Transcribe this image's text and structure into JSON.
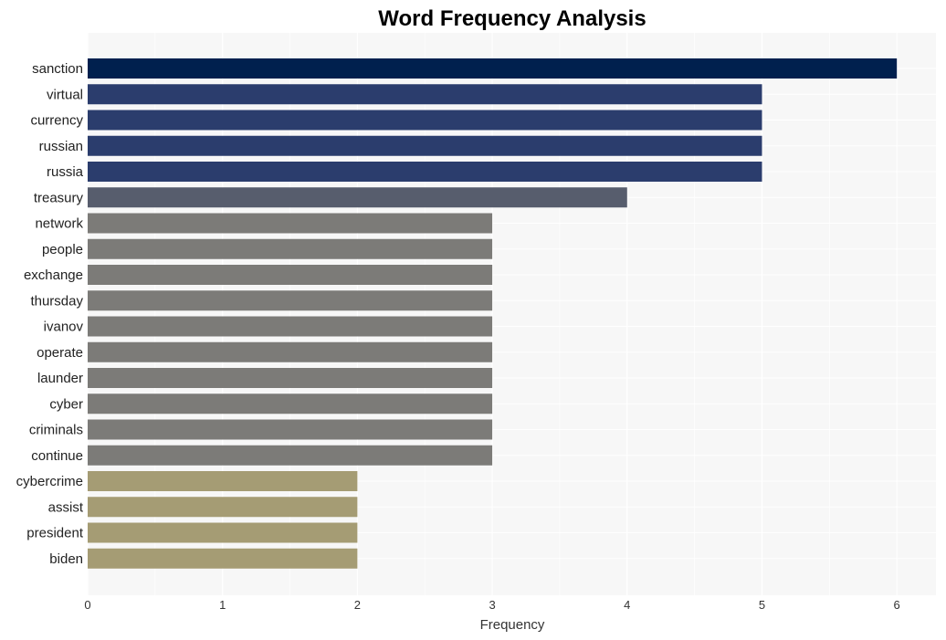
{
  "chart_data": {
    "type": "bar",
    "orientation": "horizontal",
    "title": "Word Frequency Analysis",
    "xlabel": "Frequency",
    "ylabel": "",
    "xlim": [
      0,
      6.29
    ],
    "xticks": [
      0,
      1,
      2,
      3,
      4,
      5,
      6
    ],
    "grid": true,
    "legend": "none",
    "categories": [
      "sanction",
      "virtual",
      "currency",
      "russian",
      "russia",
      "treasury",
      "network",
      "people",
      "exchange",
      "thursday",
      "ivanov",
      "operate",
      "launder",
      "cyber",
      "criminals",
      "continue",
      "cybercrime",
      "assist",
      "president",
      "biden"
    ],
    "values": [
      6,
      5,
      5,
      5,
      5,
      4,
      3,
      3,
      3,
      3,
      3,
      3,
      3,
      3,
      3,
      3,
      2,
      2,
      2,
      2
    ],
    "colors": {
      "6": "#00204e",
      "5": "#2b3d6d",
      "4": "#575d6d",
      "3": "#7c7b78",
      "2": "#a59c74"
    },
    "panel_background": "#f7f7f7",
    "grid_color": "#ffffff"
  }
}
